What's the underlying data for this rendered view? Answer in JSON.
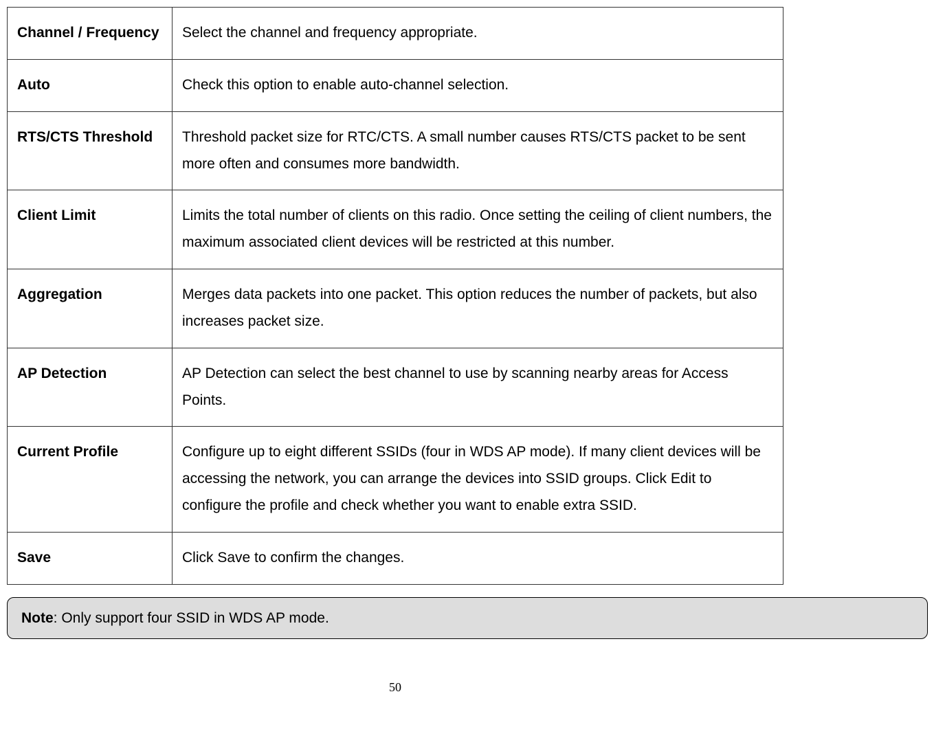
{
  "rows": [
    {
      "label": "Channel / Frequency",
      "desc": "Select the channel and frequency appropriate."
    },
    {
      "label": "Auto",
      "desc": "Check this option to enable auto-channel selection."
    },
    {
      "label": "RTS/CTS Threshold",
      "desc": "Threshold packet size for RTC/CTS. A small number causes RTS/CTS packet to be sent more often and consumes more bandwidth."
    },
    {
      "label": "Client Limit",
      "desc": "Limits the total number of clients on this radio. Once setting the ceiling of client numbers, the maximum associated client devices will be restricted at this number."
    },
    {
      "label": "Aggregation",
      "desc": "Merges data packets into one packet. This option reduces the number of packets, but also increases packet size."
    },
    {
      "label": "AP Detection",
      "desc": "AP Detection can select the best channel to use by scanning nearby areas for Access Points."
    },
    {
      "label": "Current Profile",
      "desc": "Configure up to eight different SSIDs (four in WDS AP mode). If many client devices will be accessing the network, you can arrange the devices into SSID groups. Click Edit to configure the profile and check whether you want to enable extra SSID."
    },
    {
      "label": "Save",
      "desc": "Click Save to confirm the changes."
    }
  ],
  "note": {
    "label": "Note",
    "text": ": Only support four SSID in WDS AP mode."
  },
  "page_number": "50"
}
